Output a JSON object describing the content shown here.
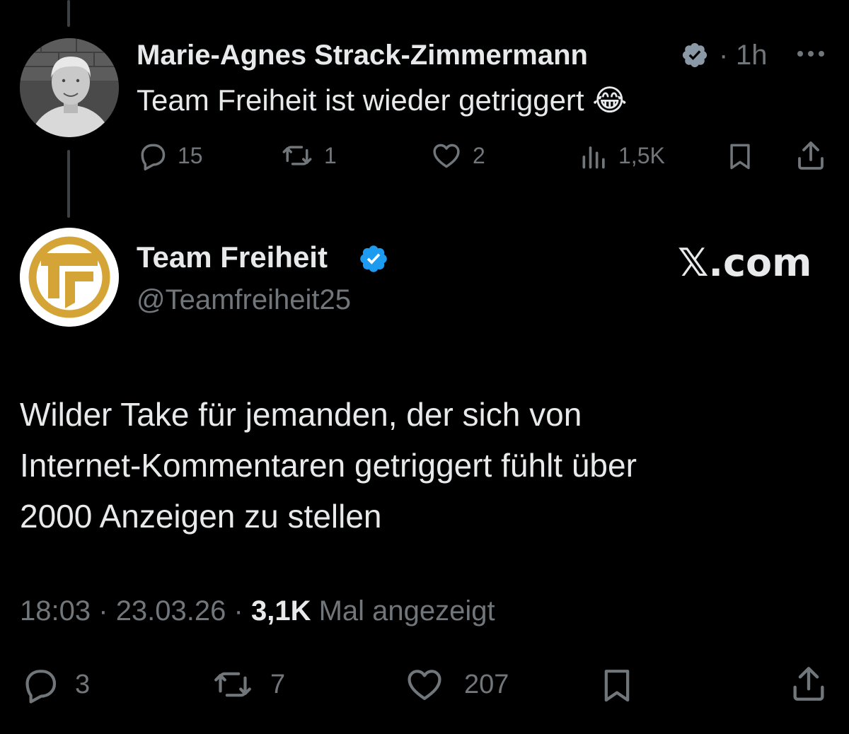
{
  "parent_tweet": {
    "author_name": "Marie-Agnes Strack-Zimmermann",
    "separator": "·",
    "time_ago": "1h",
    "text": "Team Freiheit ist wieder getriggert",
    "emoji": "😂",
    "actions": {
      "replies": "15",
      "reposts": "1",
      "likes": "2",
      "views": "1,5K"
    }
  },
  "main_tweet": {
    "author_name": "Team Freiheit",
    "handle": "@Teamfreiheit25",
    "site_mark": "𝕏.com",
    "text_lines": [
      "Wilder Take für jemanden, der sich von",
      "Internet-Kommentaren getriggert fühlt über",
      "2000 Anzeigen zu stellen"
    ],
    "meta": {
      "time": "18:03",
      "sep1": "·",
      "date": "23.03.26",
      "sep2": "·",
      "views_count": "3,1K",
      "views_label": "Mal angezeigt"
    },
    "actions": {
      "replies": "3",
      "reposts": "7",
      "likes": "207"
    }
  },
  "icons": {
    "verified": "verified-badge-icon",
    "more": "more-options-icon",
    "reply": "reply-icon",
    "repost": "repost-icon",
    "like": "heart-icon",
    "views": "views-icon",
    "bookmark": "bookmark-icon",
    "share": "share-icon"
  },
  "colors": {
    "background": "#000000",
    "text": "#e7e9ea",
    "muted": "#71767b",
    "verified": "#1d9bf0",
    "logo_gold": "#d4a437"
  }
}
